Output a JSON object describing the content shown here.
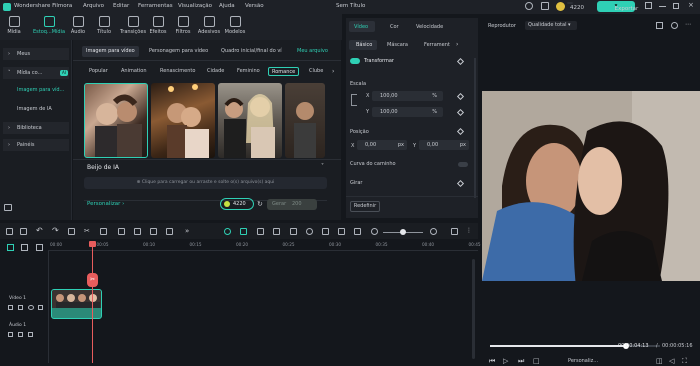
{
  "titlebar": {
    "app_name": "Wondershare Filmora",
    "menu": [
      "Arquivo",
      "Editar",
      "Ferramentas",
      "Visualização",
      "Ajuda",
      "Versão"
    ],
    "doc_title": "Sem Título",
    "credits": "4220",
    "export_label": "Exportar"
  },
  "toolbar": {
    "items": [
      {
        "label": "Mídia",
        "icon": "media-icon"
      },
      {
        "label": "Estoq...Mídia",
        "icon": "stock-media-icon"
      },
      {
        "label": "Áudio",
        "icon": "music-note-icon"
      },
      {
        "label": "Título",
        "icon": "text-icon"
      },
      {
        "label": "Transições",
        "icon": "transitions-icon"
      },
      {
        "label": "Efeitos",
        "icon": "effects-icon"
      },
      {
        "label": "Filtros",
        "icon": "filters-icon"
      },
      {
        "label": "Adesivos",
        "icon": "stickers-icon"
      },
      {
        "label": "Modelos",
        "icon": "templates-icon"
      }
    ]
  },
  "sidebar": {
    "items": [
      {
        "label": "Meus",
        "type": "group"
      },
      {
        "label": "Mídia co...",
        "type": "group",
        "badge": "AI"
      },
      {
        "label": "Imagem para víd...",
        "type": "sub",
        "selected": true
      },
      {
        "label": "Imagem de IA",
        "type": "sub"
      },
      {
        "label": "Biblioteca",
        "type": "group"
      },
      {
        "label": "Painéis",
        "type": "group"
      }
    ]
  },
  "media": {
    "tabs": [
      "Imagem para vídeo",
      "Personagem para vídeo",
      "Quadro inicial/final do ví",
      "Meu arquivo"
    ],
    "chips": [
      "Popular",
      "Animation",
      "Renascimento",
      "Cidade",
      "Feminino",
      "Romance",
      "Clube"
    ],
    "prompt_title": "Beijo de IA",
    "upload_placeholder": "Clique para carregar ou arraste e solte o(s) arquivo(s) aqui",
    "customize": "Personalizar",
    "credits_badge": "4220",
    "generate_label": "Gerar",
    "generate_badge": "200"
  },
  "props": {
    "tabs": [
      "Vídeo",
      "Cor",
      "Velocidade"
    ],
    "subtabs": [
      "Básico",
      "Máscara",
      "Ferramenta"
    ],
    "transform": "Transformar",
    "scale_label": "Escala",
    "scale_x": "100,00",
    "scale_y": "100,00",
    "scale_unit": "%",
    "pos_label": "Posição",
    "pos_x": "0,00",
    "pos_y": "0,00",
    "pos_unit": "px",
    "path_curve": "Curva do caminho",
    "rotate": "Girar",
    "reset": "Redefinir",
    "axis_x": "X",
    "axis_y": "Y"
  },
  "player": {
    "label": "Reprodutor",
    "quality": "Qualidade total",
    "current_time": "00:00:04:13",
    "separator": "/",
    "total_time": "00:00:05:16",
    "custom": "Personaliz..."
  },
  "timeline": {
    "ruler": [
      "00:00",
      "00:05",
      "00:10",
      "00:15",
      "00:20",
      "00:25",
      "00:30",
      "00:35",
      "00:40",
      "00:45"
    ],
    "track_video": "Vídeo 1",
    "track_audio": "Áudio 1",
    "progress": 0.8
  },
  "colors": {
    "accent": "#2fd0b5",
    "bg": "#14171c",
    "panel": "#1e2127",
    "playhead": "#e85d5d"
  }
}
